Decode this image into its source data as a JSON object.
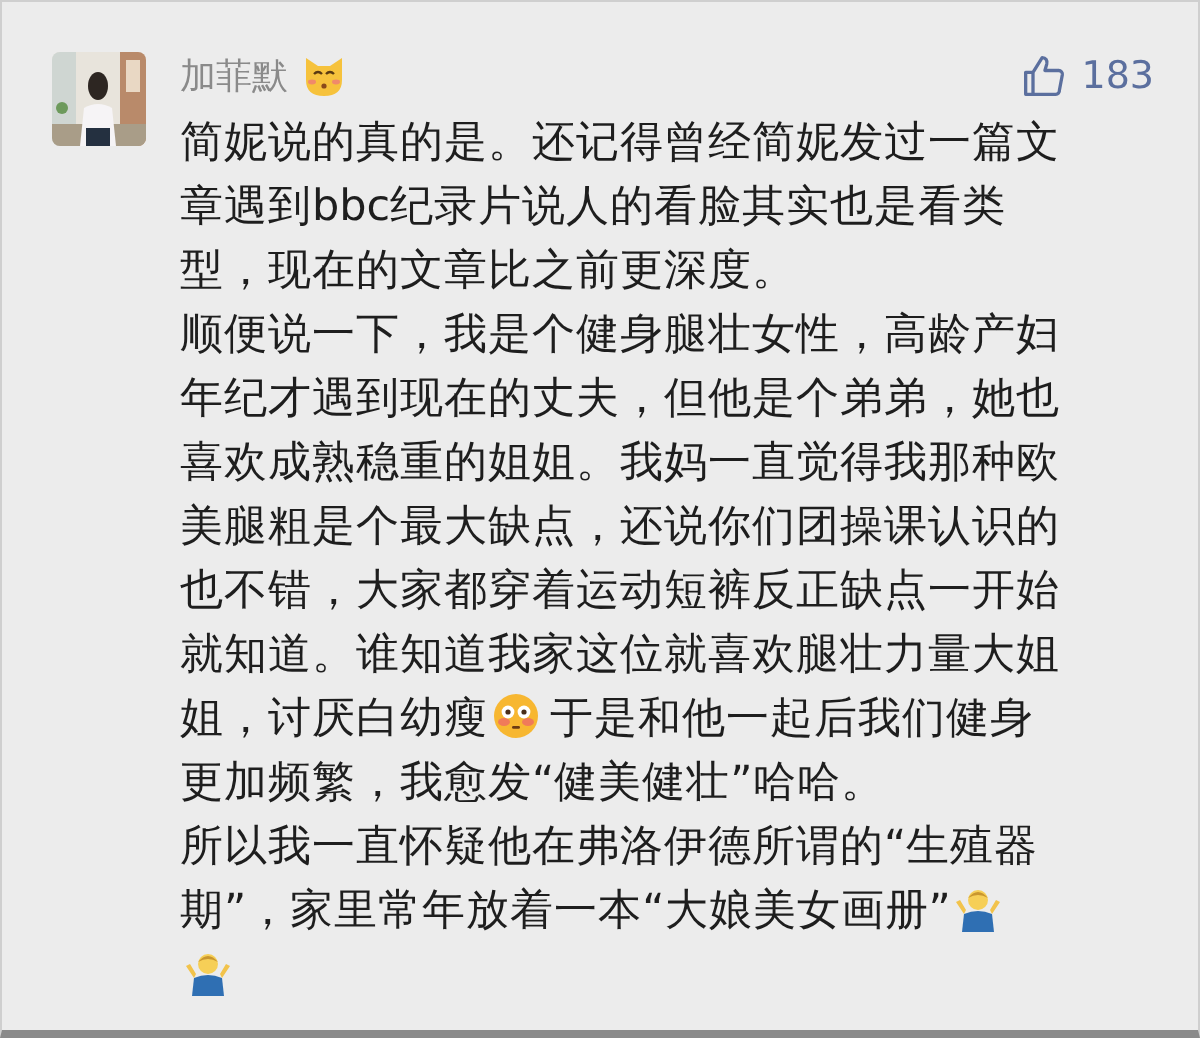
{
  "comment": {
    "author": "加菲默",
    "likes": "183",
    "lines": [
      {
        "parts": [
          {
            "kind": "text",
            "text": "简妮说的真的是。还记得曾经简妮发过一篇文"
          }
        ]
      },
      {
        "parts": [
          {
            "kind": "text",
            "text": "章遇到bbc纪录片说人的看脸其实也是看类"
          }
        ]
      },
      {
        "parts": [
          {
            "kind": "text",
            "text": "型，现在的文章比之前更深度。"
          }
        ]
      },
      {
        "parts": [
          {
            "kind": "text",
            "text": "顺便说一下，我是个健身腿壮女性，高龄产妇"
          }
        ]
      },
      {
        "parts": [
          {
            "kind": "text",
            "text": "年纪才遇到现在的丈夫，但他是个弟弟，她也"
          }
        ]
      },
      {
        "parts": [
          {
            "kind": "text",
            "text": "喜欢成熟稳重的姐姐。我妈一直觉得我那种欧"
          }
        ]
      },
      {
        "parts": [
          {
            "kind": "text",
            "text": "美腿粗是个最大缺点，还说你们团操课认识的"
          }
        ]
      },
      {
        "parts": [
          {
            "kind": "text",
            "text": "也不错，大家都穿着运动短裤反正缺点一开始"
          }
        ]
      },
      {
        "parts": [
          {
            "kind": "text",
            "text": "就知道。谁知道我家这位就喜欢腿壮力量大姐"
          }
        ]
      },
      {
        "parts": [
          {
            "kind": "text",
            "text": "姐，讨厌白幼瘦"
          },
          {
            "kind": "flushed"
          },
          {
            "kind": "text",
            "text": "于是和他一起后我们健身"
          }
        ]
      },
      {
        "parts": [
          {
            "kind": "text",
            "text": "更加频繁，我愈发“健美健壮”哈哈。"
          }
        ]
      },
      {
        "parts": [
          {
            "kind": "text",
            "text": "所以我一直怀疑他在弗洛伊德所谓的“生殖器"
          }
        ]
      },
      {
        "parts": [
          {
            "kind": "text",
            "text": "期”，家里常年放着一本“大娘美女画册”"
          },
          {
            "kind": "shrug"
          }
        ]
      },
      {
        "parts": [
          {
            "kind": "shrug"
          }
        ]
      }
    ]
  }
}
